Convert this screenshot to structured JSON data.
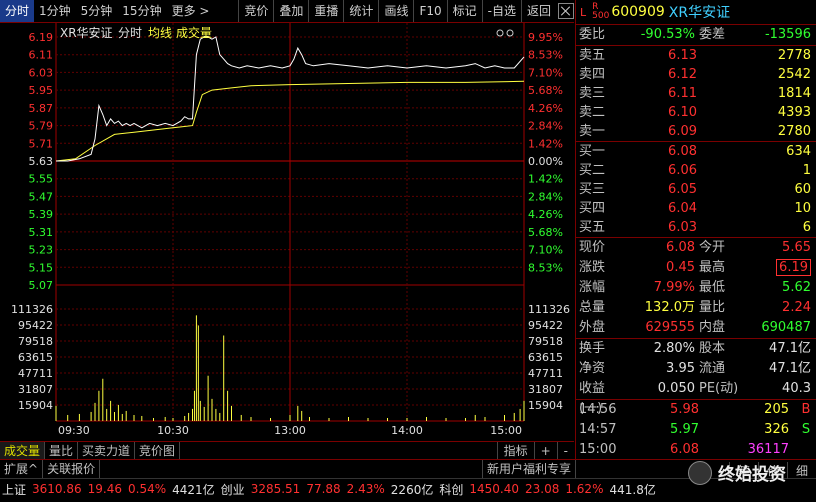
{
  "toolbar": {
    "tabs": [
      "分时",
      "1分钟",
      "5分钟",
      "15分钟",
      "更多 >"
    ],
    "buttons": [
      "竞价",
      "叠加",
      "重播",
      "统计",
      "画线",
      "F10",
      "标记",
      "-自选",
      "返回"
    ]
  },
  "chart": {
    "name_label": "XR华安证",
    "mode_label": "分时",
    "avg_label": "均线",
    "vol_label": "成交量",
    "price_ticks": [
      "6.19",
      "6.11",
      "6.03",
      "5.95",
      "5.87",
      "5.79",
      "5.71",
      "5.63",
      "5.55",
      "5.47",
      "5.39",
      "5.31",
      "5.23",
      "5.15",
      "5.07"
    ],
    "pct_ticks": [
      "9.95%",
      "8.53%",
      "7.10%",
      "5.68%",
      "4.26%",
      "2.84%",
      "1.42%",
      "0.00%",
      "1.42%",
      "2.84%",
      "4.26%",
      "5.68%",
      "7.10%",
      "8.53%"
    ],
    "vol_ticks": [
      "111326",
      "95422",
      "79518",
      "63615",
      "47711",
      "31807",
      "15904"
    ],
    "time_ticks": [
      "09:30",
      "10:30",
      "13:00",
      "14:00",
      "15:00"
    ]
  },
  "chart_data": {
    "type": "line",
    "prev_close": 5.63,
    "ylim": [
      5.07,
      6.19
    ],
    "price_series": [
      [
        0,
        5.63
      ],
      [
        6,
        5.63
      ],
      [
        12,
        5.64
      ],
      [
        18,
        5.66
      ],
      [
        20,
        5.73
      ],
      [
        22,
        5.88
      ],
      [
        24,
        5.84
      ],
      [
        26,
        5.79
      ],
      [
        28,
        5.82
      ],
      [
        30,
        5.8
      ],
      [
        32,
        5.81
      ],
      [
        34,
        5.79
      ],
      [
        36,
        5.8
      ],
      [
        38,
        5.79
      ],
      [
        40,
        5.8
      ],
      [
        44,
        5.78
      ],
      [
        48,
        5.8
      ],
      [
        52,
        5.79
      ],
      [
        56,
        5.8
      ],
      [
        60,
        5.79
      ],
      [
        64,
        5.81
      ],
      [
        66,
        5.83
      ],
      [
        68,
        5.82
      ],
      [
        70,
        5.82
      ],
      [
        72,
        6.11
      ],
      [
        74,
        6.18
      ],
      [
        76,
        6.19
      ],
      [
        78,
        6.19
      ],
      [
        80,
        6.18
      ],
      [
        82,
        6.19
      ],
      [
        84,
        6.11
      ],
      [
        86,
        6.09
      ],
      [
        88,
        6.07
      ],
      [
        90,
        6.06
      ],
      [
        94,
        6.05
      ],
      [
        98,
        6.06
      ],
      [
        104,
        6.05
      ],
      [
        110,
        6.06
      ],
      [
        116,
        6.05
      ],
      [
        120,
        6.06
      ],
      [
        122,
        6.09
      ],
      [
        124,
        6.14
      ],
      [
        126,
        6.11
      ],
      [
        128,
        6.07
      ],
      [
        132,
        6.06
      ],
      [
        140,
        6.07
      ],
      [
        150,
        6.06
      ],
      [
        160,
        6.05
      ],
      [
        170,
        6.06
      ],
      [
        180,
        6.05
      ],
      [
        190,
        6.06
      ],
      [
        200,
        6.05
      ],
      [
        210,
        6.06
      ],
      [
        215,
        6.07
      ],
      [
        220,
        6.05
      ],
      [
        225,
        6.06
      ],
      [
        230,
        6.05
      ],
      [
        235,
        6.05
      ],
      [
        240,
        6.1
      ]
    ],
    "avg_series": [
      [
        0,
        5.63
      ],
      [
        10,
        5.64
      ],
      [
        20,
        5.7
      ],
      [
        30,
        5.75
      ],
      [
        40,
        5.76
      ],
      [
        50,
        5.77
      ],
      [
        60,
        5.78
      ],
      [
        70,
        5.79
      ],
      [
        72,
        5.85
      ],
      [
        75,
        5.93
      ],
      [
        80,
        5.95
      ],
      [
        90,
        5.96
      ],
      [
        100,
        5.97
      ],
      [
        120,
        5.975
      ],
      [
        150,
        5.98
      ],
      [
        180,
        5.985
      ],
      [
        210,
        5.985
      ],
      [
        240,
        5.99
      ]
    ],
    "volume_ylim": [
      0,
      127230
    ],
    "volume": [
      [
        0,
        15000
      ],
      [
        6,
        6000
      ],
      [
        12,
        7000
      ],
      [
        18,
        9000
      ],
      [
        20,
        18000
      ],
      [
        22,
        30000
      ],
      [
        24,
        42000
      ],
      [
        26,
        12000
      ],
      [
        28,
        20000
      ],
      [
        30,
        9000
      ],
      [
        32,
        16000
      ],
      [
        34,
        7000
      ],
      [
        36,
        10000
      ],
      [
        40,
        6000
      ],
      [
        44,
        5000
      ],
      [
        50,
        3000
      ],
      [
        56,
        4000
      ],
      [
        60,
        3000
      ],
      [
        66,
        5000
      ],
      [
        68,
        8000
      ],
      [
        70,
        12000
      ],
      [
        71,
        30000
      ],
      [
        72,
        105000
      ],
      [
        73,
        95000
      ],
      [
        74,
        20000
      ],
      [
        76,
        14000
      ],
      [
        78,
        45000
      ],
      [
        80,
        22000
      ],
      [
        82,
        12000
      ],
      [
        84,
        8000
      ],
      [
        86,
        85000
      ],
      [
        88,
        30000
      ],
      [
        90,
        15000
      ],
      [
        95,
        6000
      ],
      [
        100,
        4000
      ],
      [
        110,
        3000
      ],
      [
        120,
        6000
      ],
      [
        124,
        15000
      ],
      [
        126,
        10000
      ],
      [
        130,
        4000
      ],
      [
        140,
        3000
      ],
      [
        150,
        4000
      ],
      [
        160,
        3000
      ],
      [
        170,
        3000
      ],
      [
        180,
        3000
      ],
      [
        190,
        4000
      ],
      [
        200,
        3000
      ],
      [
        210,
        3000
      ],
      [
        215,
        6000
      ],
      [
        220,
        4000
      ],
      [
        230,
        6000
      ],
      [
        235,
        8000
      ],
      [
        238,
        12000
      ],
      [
        240,
        20000
      ]
    ]
  },
  "bottom_tabs": [
    "成交量",
    "量比",
    "买卖力道",
    "竞价图"
  ],
  "bottom_right": [
    "指标",
    "+",
    "-"
  ],
  "quote": {
    "l_label": "L",
    "r_label": "R",
    "r_sub": "500",
    "code": "600909",
    "name": "XR华安证",
    "weibi_label": "委比",
    "weibi": "-90.53%",
    "weicha_label": "委差",
    "weicha": "-13596",
    "sells": [
      {
        "label": "卖五",
        "price": "6.13",
        "vol": "2778"
      },
      {
        "label": "卖四",
        "price": "6.12",
        "vol": "2542"
      },
      {
        "label": "卖三",
        "price": "6.11",
        "vol": "1814"
      },
      {
        "label": "卖二",
        "price": "6.10",
        "vol": "4393"
      },
      {
        "label": "卖一",
        "price": "6.09",
        "vol": "2780"
      }
    ],
    "buys": [
      {
        "label": "买一",
        "price": "6.08",
        "vol": "634"
      },
      {
        "label": "买二",
        "price": "6.06",
        "vol": "1"
      },
      {
        "label": "买三",
        "price": "6.05",
        "vol": "60"
      },
      {
        "label": "买四",
        "price": "6.04",
        "vol": "10"
      },
      {
        "label": "买五",
        "price": "6.03",
        "vol": "6"
      }
    ],
    "stats1": [
      {
        "l": "现价",
        "v": "6.08",
        "l2": "今开",
        "v2": "5.65"
      },
      {
        "l": "涨跌",
        "v": "0.45",
        "l2": "最高",
        "v2": "6.19"
      },
      {
        "l": "涨幅",
        "v": "7.99%",
        "l2": "最低",
        "v2": "5.62"
      },
      {
        "l": "总量",
        "v": "132.0万",
        "l2": "量比",
        "v2": "2.24"
      },
      {
        "l": "外盘",
        "v": "629555",
        "l2": "内盘",
        "v2": "690487"
      }
    ],
    "stats2": [
      {
        "l": "换手",
        "v": "2.80%",
        "l2": "股本",
        "v2": "47.1亿"
      },
      {
        "l": "净资",
        "v": "3.95",
        "l2": "流通",
        "v2": "47.1亿"
      },
      {
        "l": "收益(一)",
        "v": "0.050",
        "l2": "PE(动)",
        "v2": "40.3"
      }
    ],
    "ticks": [
      {
        "t": "14:56",
        "p": "5.98",
        "v": "205",
        "s": "B"
      },
      {
        "t": "14:57",
        "p": "5.97",
        "v": "326",
        "s": "S"
      },
      {
        "t": "15:00",
        "p": "6.08",
        "v": "36117",
        "s": ""
      }
    ]
  },
  "statusbar": {
    "tabs": [
      "扩展^",
      "关联报价"
    ],
    "promo": "新用户福利专享",
    "right_btns": [
      "笔",
      "价",
      "细"
    ],
    "sh_label": "上证",
    "sh_val": "3610.86",
    "sh_chg": "19.46",
    "sh_pct": "0.54%",
    "sh_amt": "4421亿",
    "cy_label": "创业",
    "cy_val": "3285.51",
    "cy_chg": "77.88",
    "cy_pct": "2.43%",
    "cy_amt": "2260亿",
    "kc_label": "科创",
    "kc_val": "1450.40",
    "kc_chg": "23.08",
    "kc_pct": "1.62%",
    "kc_amt": "441.8亿",
    "watermark": "终始投资"
  }
}
